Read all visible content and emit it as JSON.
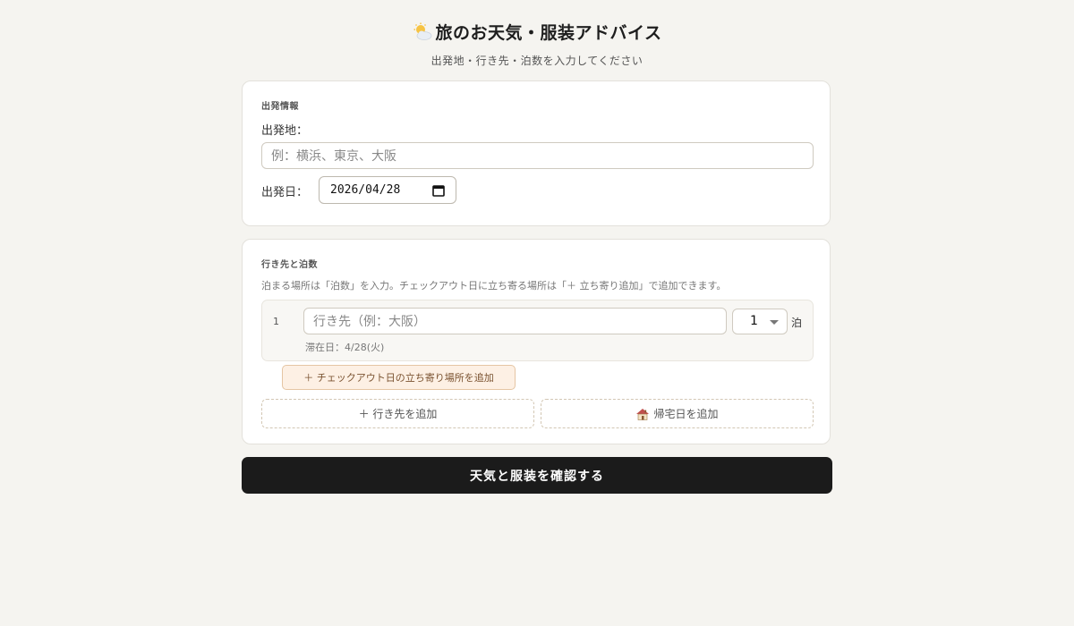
{
  "header": {
    "title_icon": "sun-behind-cloud-icon",
    "title": "旅のお天気・服装アドバイス",
    "subtitle": "出発地・行き先・泊数を入力してください"
  },
  "departure": {
    "section_title": "出発情報",
    "origin_label": "出発地：",
    "origin_placeholder": "例：横浜、東京、大阪",
    "date_label": "出発日：",
    "date_value": "2026/04/28",
    "date_icon": "calendar-icon"
  },
  "destinations": {
    "section_title": "行き先と泊数",
    "hint": "泊まる場所は「泊数」を入力。チェックアウト日に立ち寄る場所は「＋ 立ち寄り追加」で追加できます。",
    "rows": [
      {
        "index": "1",
        "placeholder": "行き先（例：大阪）",
        "nights": "1",
        "nights_unit": "泊",
        "stay_date": "滞在日：4/28(火)"
      }
    ],
    "add_stopover_label": "＋ チェックアウト日の立ち寄り場所を追加",
    "add_destination_label": "＋ 行き先を追加",
    "add_home_icon": "house-icon",
    "add_home_label": "帰宅日を追加"
  },
  "submit": {
    "label": "天気と服装を確認する"
  },
  "colors": {
    "background": "#f5f4f0",
    "submit_bg": "#1b1b1b",
    "stopover_bg": "#fdf0e4"
  }
}
